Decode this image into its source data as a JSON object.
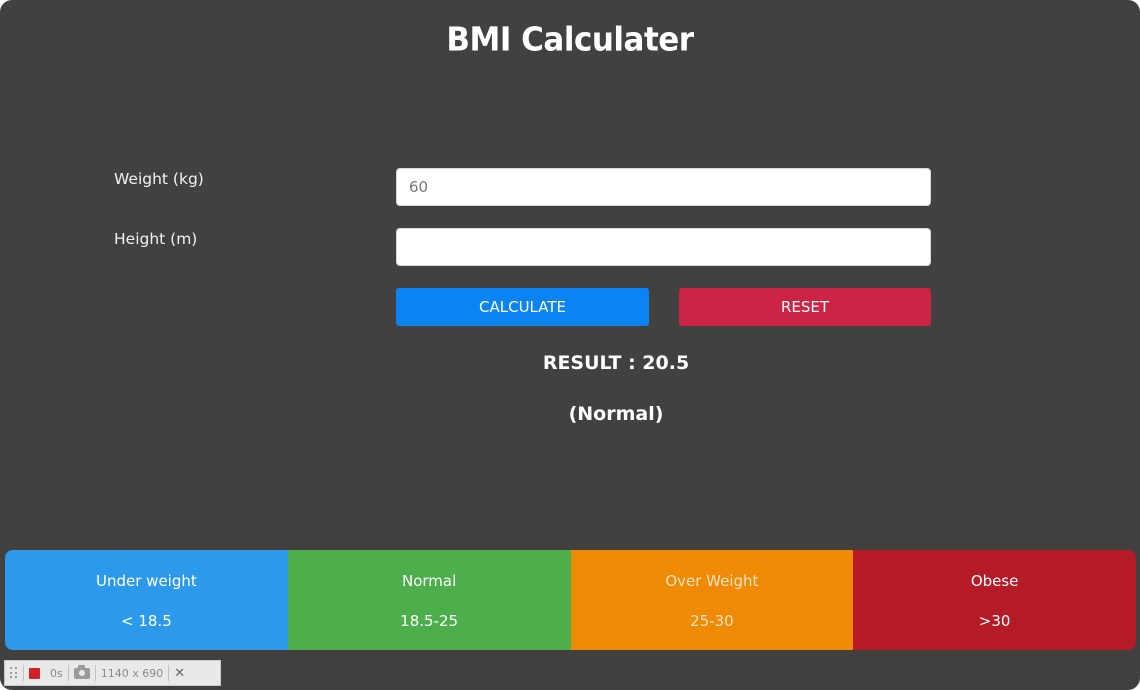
{
  "app": {
    "title": "BMI Calculater"
  },
  "form": {
    "weight_label": "Weight (kg)",
    "weight_value": "60",
    "weight_placeholder": "",
    "height_label": "Height (m)",
    "height_value": "",
    "height_placeholder": ""
  },
  "buttons": {
    "calculate_label": "CALCULATE",
    "reset_label": "RESET"
  },
  "result": {
    "value_text": "RESULT : 20.5",
    "status_text": "(Normal)"
  },
  "categories": [
    {
      "name": "Under weight",
      "range": "< 18.5",
      "color": "#2c99ea"
    },
    {
      "name": "Normal",
      "range": "18.5-25",
      "color": "#4caf4c"
    },
    {
      "name": "Over Weight",
      "range": "25-30",
      "color": "#ef8a04"
    },
    {
      "name": "Obese",
      "range": ">30",
      "color": "#b51a27"
    }
  ],
  "recorder_toolbar": {
    "elapsed": "0s",
    "dimensions": "1140 x 690",
    "icons": [
      "drag-handle-icon",
      "record-stop-icon",
      "camera-icon",
      "close-icon"
    ]
  },
  "colors": {
    "background": "#434140",
    "calculate": "#0a84f3",
    "reset": "#cb2444"
  }
}
